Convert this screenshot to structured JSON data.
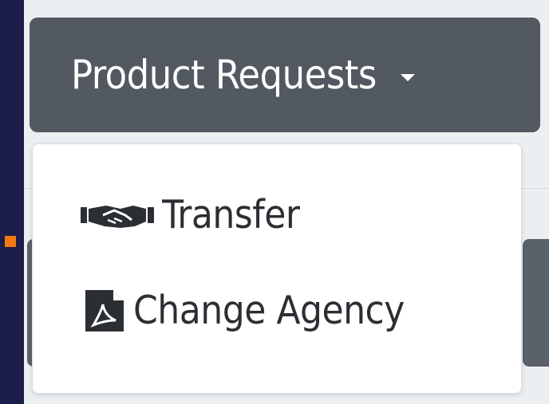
{
  "toggle": {
    "label": "Product Requests",
    "icon": "caret-down-icon"
  },
  "menu": {
    "items": [
      {
        "label": "Transfer",
        "icon": "handshake-icon"
      },
      {
        "label": "Change Agency",
        "icon": "file-pdf-icon"
      }
    ]
  },
  "colors": {
    "toggle_bg": "#535961",
    "menu_bg": "#ffffff",
    "text_dark": "#2b2f33",
    "page_edge": "#1c1d4a",
    "marker": "#f07a10"
  }
}
